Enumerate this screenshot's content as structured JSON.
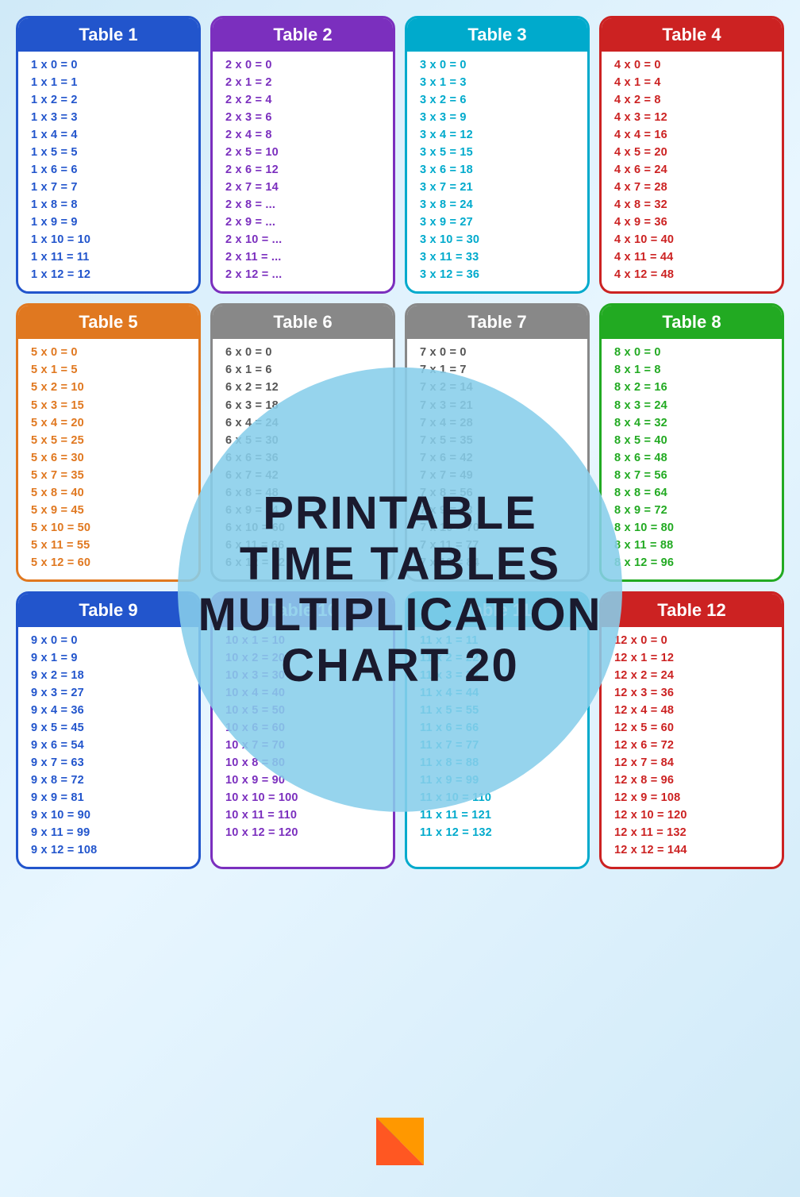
{
  "page": {
    "background_color": "#d0eaf8",
    "title": "Printable Time Tables Multiplication Chart 20"
  },
  "circle": {
    "line1": "Printable",
    "line2": "Time Tables",
    "line3": "Multiplication",
    "line4": "Chart 20"
  },
  "tables": [
    {
      "id": 1,
      "label": "Table 1",
      "color_class": "table-1",
      "rows": [
        "1 x 0 = 0",
        "1 x 1 = 1",
        "1 x 2 = 2",
        "1 x 3 = 3",
        "1 x 4 = 4",
        "1 x 5 = 5",
        "1 x 6 = 6",
        "1 x 7 = 7",
        "1 x 8 = 8",
        "1 x 9 = 9",
        "1 x 10 = 10",
        "1 x 11 = 11",
        "1 x 12 = 12"
      ]
    },
    {
      "id": 2,
      "label": "Table 2",
      "color_class": "table-2",
      "rows": [
        "2 x 0 = 0",
        "2 x 1 = 2",
        "2 x 2 = 4",
        "2 x 3 = 6",
        "2 x 4 = 8",
        "2 x 5 = 10",
        "2 x 6 = 12",
        "2 x 7 = 14",
        "2 x 8 = ...",
        "2 x 9 = ...",
        "2 x 10 = ...",
        "2 x 11 = ...",
        "2 x 12 = ..."
      ]
    },
    {
      "id": 3,
      "label": "Table 3",
      "color_class": "table-3",
      "rows": [
        "3 x 0 = 0",
        "3 x 1 = 3",
        "3 x 2 = 6",
        "3 x 3 = 9",
        "3 x 4 = 12",
        "3 x 5 = 15",
        "3 x 6 = 18",
        "3 x 7 = 21",
        "3 x 8 = 24",
        "3 x 9 = 27",
        "3 x 10 = 30",
        "3 x 11 = 33",
        "3 x 12 = 36"
      ]
    },
    {
      "id": 4,
      "label": "Table 4",
      "color_class": "table-4",
      "rows": [
        "4 x 0 = 0",
        "4 x 1 = 4",
        "4 x 2 = 8",
        "4 x 3 = 12",
        "4 x 4 = 16",
        "4 x 5 = 20",
        "4 x 6 = 24",
        "4 x 7 = 28",
        "4 x 8 = 32",
        "4 x 9 = 36",
        "4 x 10 = 40",
        "4 x 11 = 44",
        "4 x 12 = 48"
      ]
    },
    {
      "id": 5,
      "label": "Table 5",
      "color_class": "table-5",
      "rows": [
        "5 x 0 = 0",
        "5 x 1 = 5",
        "5 x 2 = 10",
        "5 x 3 = 15",
        "5 x 4 = 20",
        "5 x 5 = 25",
        "5 x 6 = 30",
        "5 x 7 = 35",
        "5 x 8 = 40",
        "5 x 9 = 45",
        "5 x 10 = 50",
        "5 x 11 = 55",
        "5 x 12 = 60"
      ]
    },
    {
      "id": 6,
      "label": "Table 6",
      "color_class": "table-6",
      "rows": [
        "6 x 0 = 0",
        "6 x 1 = 6",
        "6 x 2 = 12",
        "6 x 3 = 18",
        "6 x 4 = 24",
        "6 x 5 = 30",
        "6 x 6 = 36",
        "6 x 7 = 42",
        "6 x 8 = 48",
        "6 x 9 = 54",
        "6 x 10 = 60",
        "6 x 11 = 66",
        "6 x 12 = 72"
      ]
    },
    {
      "id": 7,
      "label": "Table 7",
      "color_class": "table-7",
      "rows": [
        "7 x 0 = 0",
        "7 x 1 = 7",
        "7 x 2 = 14",
        "7 x 3 = 21",
        "7 x 4 = 28",
        "7 x 5 = 35",
        "7 x 6 = 42",
        "7 x 7 = 49",
        "7 x 8 = 56",
        "7 x 9 = 63",
        "7 x 10 = 70",
        "7 x 11 = 77",
        "7 x 12 = 84"
      ]
    },
    {
      "id": 8,
      "label": "Table 8",
      "color_class": "table-8",
      "rows": [
        "8 x 0 = 0",
        "8 x 1 = 8",
        "8 x 2 = 16",
        "8 x 3 = 24",
        "8 x 4 = 32",
        "8 x 5 = 40",
        "8 x 6 = 48",
        "8 x 7 = 56",
        "8 x 8 = 64",
        "8 x 9 = 72",
        "8 x 10 = 80",
        "8 x 11 = 88",
        "8 x 12 = 96"
      ]
    },
    {
      "id": 9,
      "label": "Table 9",
      "color_class": "table-9",
      "rows": [
        "9 x 0 = 0",
        "9 x 1 = 9",
        "9 x 2 = 18",
        "9 x 3 = 27",
        "9 x 4 = 36",
        "9 x 5 = 45",
        "9 x 6 = 54",
        "9 x 7 = 63",
        "9 x 8 = 72",
        "9 x 9 = 81",
        "9 x 10 = 90",
        "9 x 11 = 99",
        "9 x 12 = 108"
      ]
    },
    {
      "id": 10,
      "label": "Table 10",
      "color_class": "table-10",
      "rows": [
        "10 x 1 = 10",
        "10 x 2 = 20",
        "10 x 3 = 30",
        "10 x 4 = 40",
        "10 x 5 = 50",
        "10 x 6 = 60",
        "10 x 7 = 70",
        "10 x 8 = 80",
        "10 x 9 = 90",
        "10 x 10 = 100",
        "10 x 11 = 110",
        "10 x 12 = 120"
      ]
    },
    {
      "id": 11,
      "label": "Table 11",
      "color_class": "table-11",
      "rows": [
        "11 x 1 = 11",
        "11 x 2 = 22",
        "11 x 3 = 33",
        "11 x 4 = 44",
        "11 x 5 = 55",
        "11 x 6 = 66",
        "11 x 7 = 77",
        "11 x 8 = 88",
        "11 x 9 = 99",
        "11 x 10 = 110",
        "11 x 11 = 121",
        "11 x 12 = 132"
      ]
    },
    {
      "id": 12,
      "label": "Table 12",
      "color_class": "table-12",
      "rows": [
        "12 x 0 = 0",
        "12 x 1 = 12",
        "12 x 2 = 24",
        "12 x 3 = 36",
        "12 x 4 = 48",
        "12 x 5 = 60",
        "12 x 6 = 72",
        "12 x 7 = 84",
        "12 x 8 = 96",
        "12 x 9 = 108",
        "12 x 10 = 120",
        "12 x 11 = 132",
        "12 x 12 = 144"
      ]
    }
  ]
}
